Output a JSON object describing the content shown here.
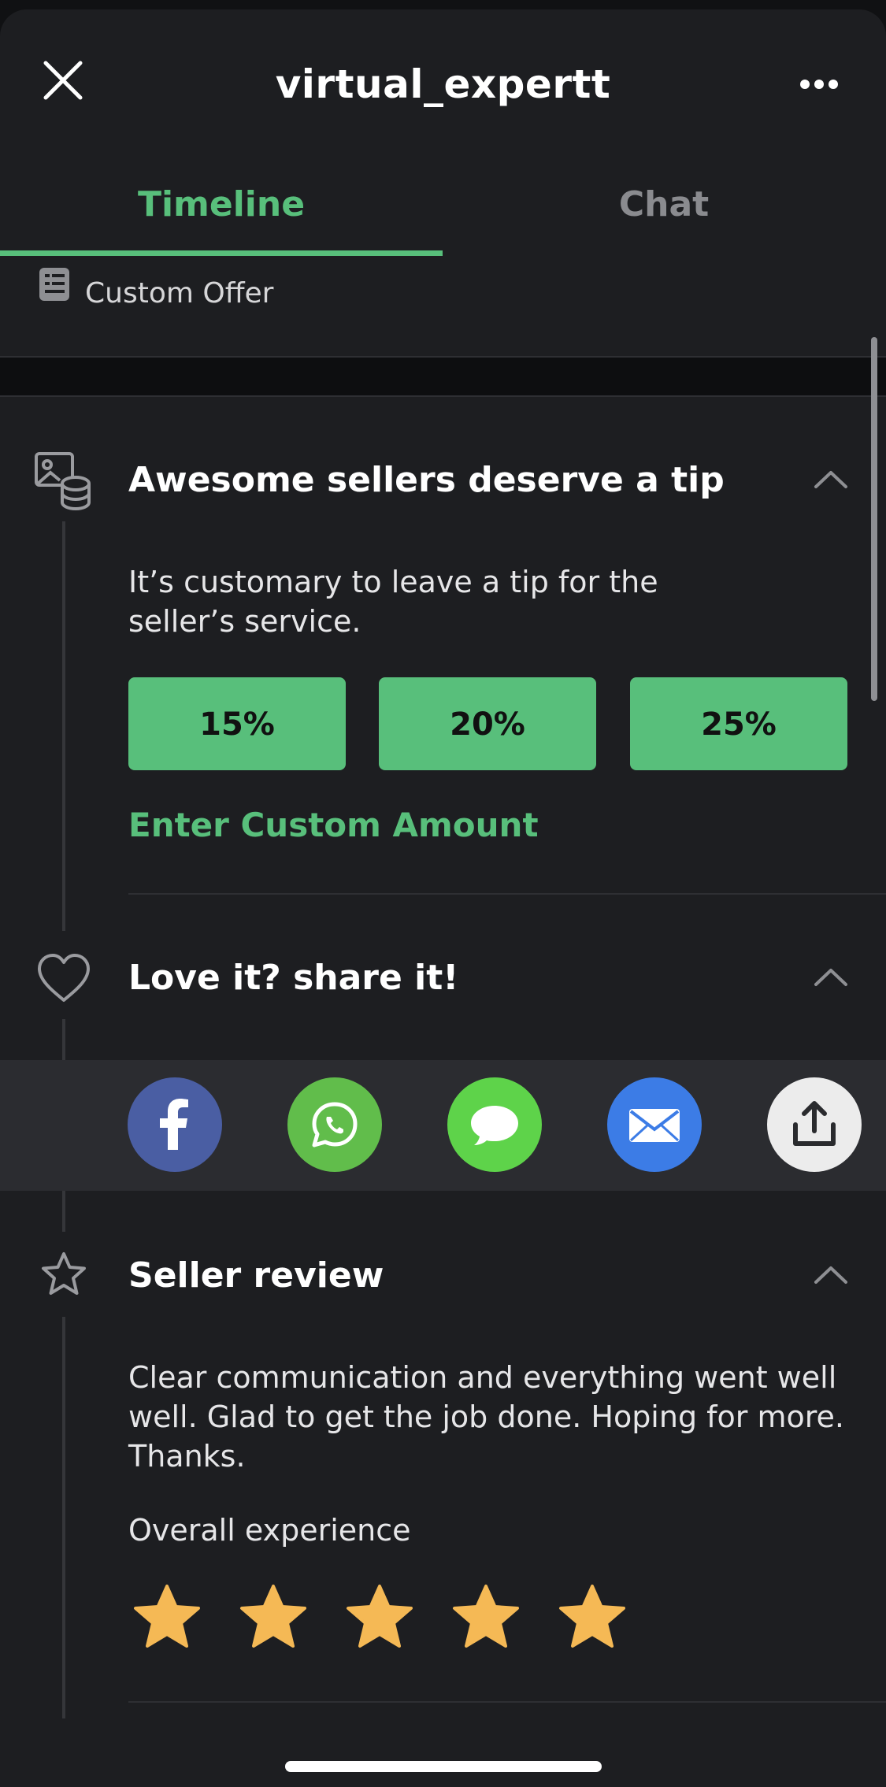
{
  "header": {
    "title": "virtual_expertt",
    "close_icon": "close-icon",
    "more_icon": "more-horizontal-icon"
  },
  "tabs": [
    {
      "label": "Timeline",
      "active": true
    },
    {
      "label": "Chat",
      "active": false
    }
  ],
  "custom_offer": {
    "icon": "document-list-icon",
    "label": "Custom Offer"
  },
  "tip_section": {
    "icon": "image-coins-icon",
    "title": "Awesome sellers deserve a tip",
    "description_line1": "It’s customary to leave a tip for the",
    "description_line2": "seller’s service.",
    "options": [
      "15%",
      "20%",
      "25%"
    ],
    "custom_amount": "Enter Custom Amount"
  },
  "share_section": {
    "icon": "heart-icon",
    "title": "Love it? share it!",
    "targets": [
      "facebook",
      "whatsapp",
      "messages",
      "mail",
      "share"
    ]
  },
  "review_section": {
    "icon": "star-outline-icon",
    "title": "Seller review",
    "review_line1": "Clear communication and everything went well",
    "review_line2": "well. Glad to get the job done. Hoping for more.",
    "review_line3": "Thanks.",
    "experience_label": "Overall experience",
    "rating": 5,
    "rating_max": 5
  },
  "colors": {
    "accent": "#58bf7b",
    "background": "#1d1e21",
    "star": "#f5b955",
    "facebook": "#4a5ea3",
    "whatsapp": "#61bd4b",
    "messages": "#5ed34a",
    "mail": "#3c7ce6",
    "share": "#ececec"
  }
}
